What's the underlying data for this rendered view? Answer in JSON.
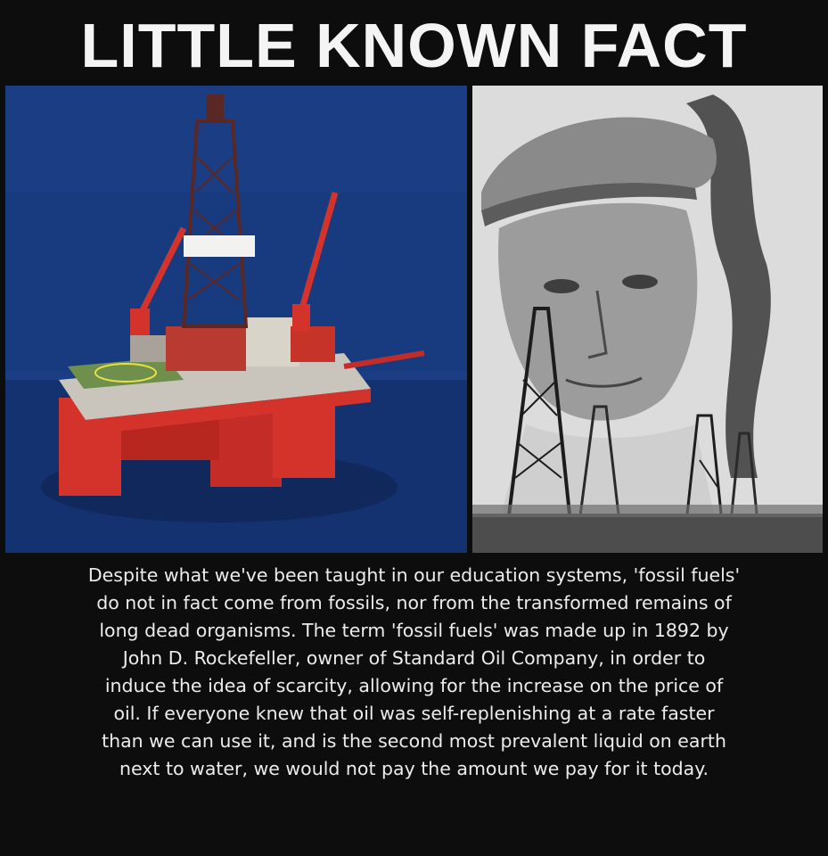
{
  "headline": "LITTLE KNOWN FACT",
  "caption_lines": [
    "Despite what we've been taught in our education systems, 'fossil fuels'",
    "do not in fact come from fossils, nor from the transformed remains of",
    "long dead organisms. The term 'fossil fuels' was made up in 1892 by",
    "John D. Rockefeller, owner of Standard Oil Company, in order to",
    "induce the idea of scarcity, allowing for the increase on the price of",
    "oil. If everyone knew that oil was self-replenishing at a rate faster",
    "than we can use it, and is the second most prevalent liquid on earth",
    "next to water, we would not pay the amount we pay for it today."
  ],
  "colors": {
    "background": "#0d0d0d",
    "text": "#ececec",
    "ocean": "#173a80",
    "rig_red": "#d4332b"
  }
}
